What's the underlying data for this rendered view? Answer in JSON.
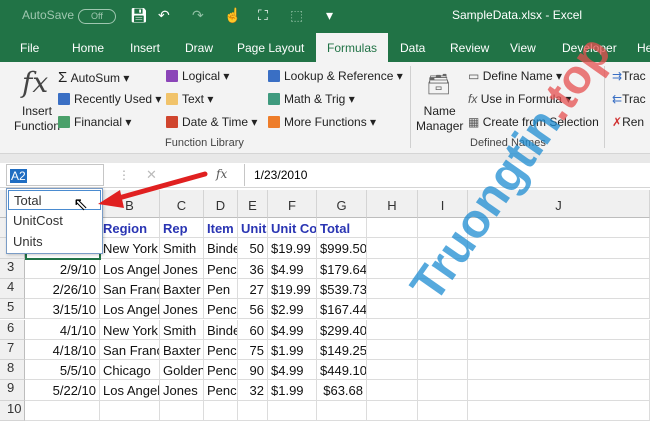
{
  "titlebar": {
    "autosave": "AutoSave",
    "toggle": "Off",
    "title": "SampleData.xlsx  -  Excel"
  },
  "tabs": [
    "File",
    "Home",
    "Insert",
    "Draw",
    "Page Layout",
    "Formulas",
    "Data",
    "Review",
    "View",
    "Developer",
    "He"
  ],
  "active_tab": "Formulas",
  "ribbon": {
    "insert_function": [
      "Insert",
      "Function"
    ],
    "function_library": {
      "items": [
        "AutoSum",
        "Recently Used",
        "Financial",
        "Logical",
        "Text",
        "Date & Time",
        "Lookup & Reference",
        "Math & Trig",
        "More Functions"
      ],
      "label": "Function Library"
    },
    "defined_names": {
      "name_manager": [
        "Name",
        "Manager"
      ],
      "items": [
        "Define Name",
        "Use in Formula",
        "Create from Selection"
      ],
      "label": "Defined Names"
    },
    "auditing": [
      "Trac",
      "Trac",
      "Ren"
    ]
  },
  "formula_bar": {
    "name_box": "A2",
    "cancel": "✕",
    "fx": "fx",
    "value": "1/23/2010"
  },
  "name_dropdown": [
    "Total",
    "UnitCost",
    "Units"
  ],
  "columns": [
    "A",
    "B",
    "C",
    "D",
    "E",
    "F",
    "G",
    "H",
    "I",
    "J"
  ],
  "rows": [
    {
      "n": "1",
      "cells": [
        "",
        "Region",
        "Rep",
        "Item",
        "Units",
        "Unit Cost",
        "Total"
      ]
    },
    {
      "n": "2",
      "cells": [
        "",
        "New York",
        "Smith",
        "Binder",
        "50",
        "$19.99",
        "$999.50"
      ]
    },
    {
      "n": "3",
      "cells": [
        "2/9/10",
        "Los Angeles",
        "Jones",
        "Pencil",
        "36",
        "$4.99",
        "$179.64"
      ]
    },
    {
      "n": "4",
      "cells": [
        "2/26/10",
        "San Francisco",
        "Baxter",
        "Pen",
        "27",
        "$19.99",
        "$539.73"
      ]
    },
    {
      "n": "5",
      "cells": [
        "3/15/10",
        "Los Angeles",
        "Jones",
        "Pencil",
        "56",
        "$2.99",
        "$167.44"
      ]
    },
    {
      "n": "6",
      "cells": [
        "4/1/10",
        "New York",
        "Smith",
        "Binder",
        "60",
        "$4.99",
        "$299.40"
      ]
    },
    {
      "n": "7",
      "cells": [
        "4/18/10",
        "San Francisco",
        "Baxter",
        "Pencil",
        "75",
        "$1.99",
        "$149.25"
      ]
    },
    {
      "n": "8",
      "cells": [
        "5/5/10",
        "Chicago",
        "Golden",
        "Pencil",
        "90",
        "$4.99",
        "$449.10"
      ]
    },
    {
      "n": "9",
      "cells": [
        "5/22/10",
        "Los Angeles",
        "Jones",
        "Pencil",
        "32",
        "$1.99",
        "$63.68"
      ]
    },
    {
      "n": "10",
      "cells": [
        "",
        "",
        "",
        "",
        "",
        "",
        ""
      ]
    }
  ],
  "watermark": {
    "a": "Truongtin",
    "b": ".top"
  },
  "colors": {
    "excel_green": "#217346",
    "header_blue": "#2a35b3",
    "arrow": "#e02020"
  }
}
